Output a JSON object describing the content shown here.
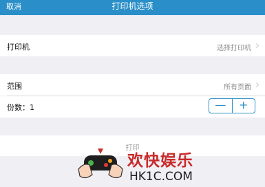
{
  "navbar": {
    "cancel_label": "取消",
    "title": "打印机选项"
  },
  "printer_row": {
    "label": "打印机",
    "value": "选择打印机"
  },
  "range_row": {
    "label": "范围",
    "value": "所有页面"
  },
  "copies_row": {
    "label": "份数：1",
    "minus": "—",
    "plus": "+"
  },
  "print_button": {
    "label": "打印"
  },
  "watermark": {
    "brand": "欢快娱乐",
    "domain": "HK1C.COM"
  },
  "colors": {
    "accent": "#2a8fc8",
    "background": "#efeff4",
    "watermark_red": "#c92a2a"
  }
}
